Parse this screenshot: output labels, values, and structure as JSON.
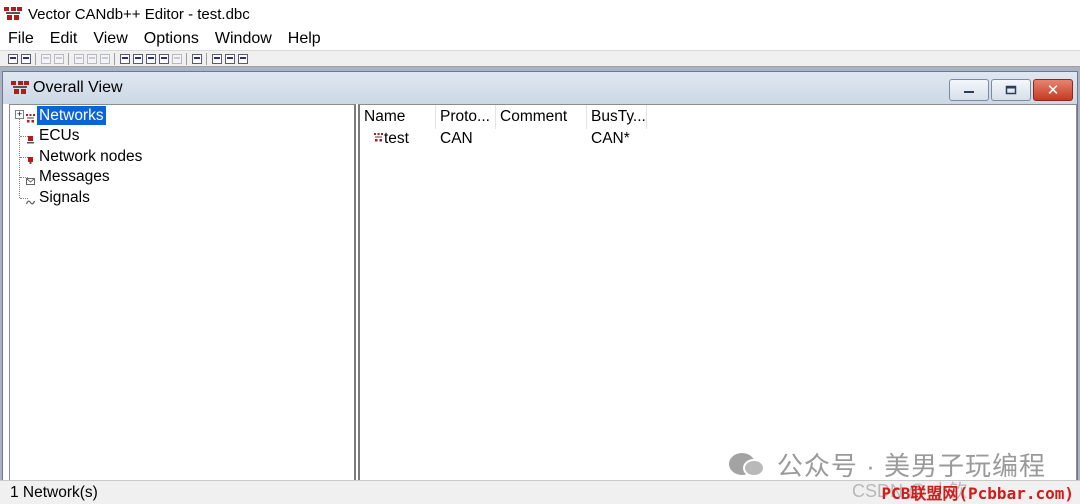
{
  "app": {
    "title": "Vector CANdb++ Editor - test.dbc",
    "icon": "candb-network-icon"
  },
  "menu": [
    {
      "label": "File"
    },
    {
      "label": "Edit"
    },
    {
      "label": "View"
    },
    {
      "label": "Options"
    },
    {
      "label": "Window"
    },
    {
      "label": "Help"
    }
  ],
  "child_window": {
    "title": "Overall View",
    "minimize_icon": "minimize-icon",
    "maximize_icon": "maximize-icon",
    "close_icon": "close-icon",
    "close_glyph": "✕"
  },
  "tree": {
    "items": [
      {
        "label": "Networks",
        "icon": "network-icon",
        "selected": true,
        "expander": "+"
      },
      {
        "label": "ECUs",
        "icon": "ecu-icon"
      },
      {
        "label": "Network nodes",
        "icon": "node-icon"
      },
      {
        "label": "Messages",
        "icon": "message-icon"
      },
      {
        "label": "Signals",
        "icon": "signal-icon"
      }
    ]
  },
  "list": {
    "columns": [
      "Name",
      "Proto...",
      "Comment",
      "BusTy..."
    ],
    "rows": [
      {
        "name": "test",
        "protocol": "CAN",
        "comment": "",
        "bustype": "CAN*",
        "icon": "network-icon"
      }
    ]
  },
  "status": {
    "text": "1 Network(s)"
  },
  "watermark": {
    "channel": "公众号 · 美男子玩编程",
    "site": "PCB联盟网(Pcbbar.com)",
    "csdn": "CSDN @ 小钦"
  },
  "colors": {
    "selection": "#0a64d8",
    "mdi_background": "#a9b3c2",
    "close_button": "#c43a22",
    "icon_red": "#b31a1a"
  }
}
